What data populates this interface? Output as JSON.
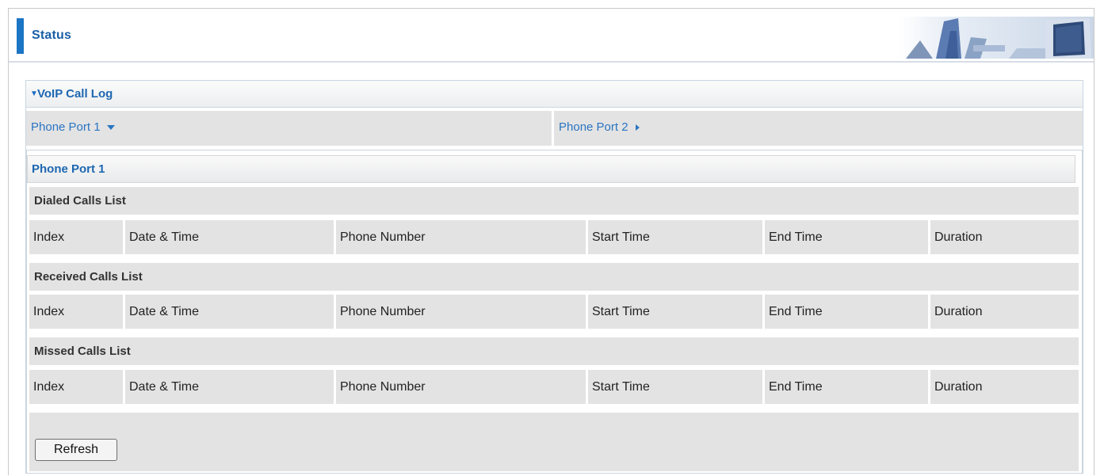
{
  "header": {
    "title": "Status"
  },
  "section": {
    "title": "VoIP Call Log"
  },
  "tabs": [
    {
      "label": "Phone Port 1",
      "state": "expanded"
    },
    {
      "label": "Phone Port 2",
      "state": "collapsed"
    }
  ],
  "port": {
    "title": "Phone Port 1",
    "lists": [
      {
        "title": "Dialed Calls List",
        "columns": [
          "Index",
          "Date & Time",
          "Phone Number",
          "Start Time",
          "End Time",
          "Duration"
        ]
      },
      {
        "title": "Received Calls List",
        "columns": [
          "Index",
          "Date & Time",
          "Phone Number",
          "Start Time",
          "End Time",
          "Duration"
        ]
      },
      {
        "title": "Missed Calls List",
        "columns": [
          "Index",
          "Date & Time",
          "Phone Number",
          "Start Time",
          "End Time",
          "Duration"
        ]
      }
    ]
  },
  "actions": {
    "refresh_label": "Refresh"
  },
  "icons": {
    "section_toggle": "triangle-down-icon",
    "tab_expanded": "caret-down-icon",
    "tab_collapsed": "caret-right-icon"
  },
  "colors": {
    "accent": "#1b75c4",
    "link": "#2b75c2",
    "cell_bg": "#e3e3e3"
  }
}
